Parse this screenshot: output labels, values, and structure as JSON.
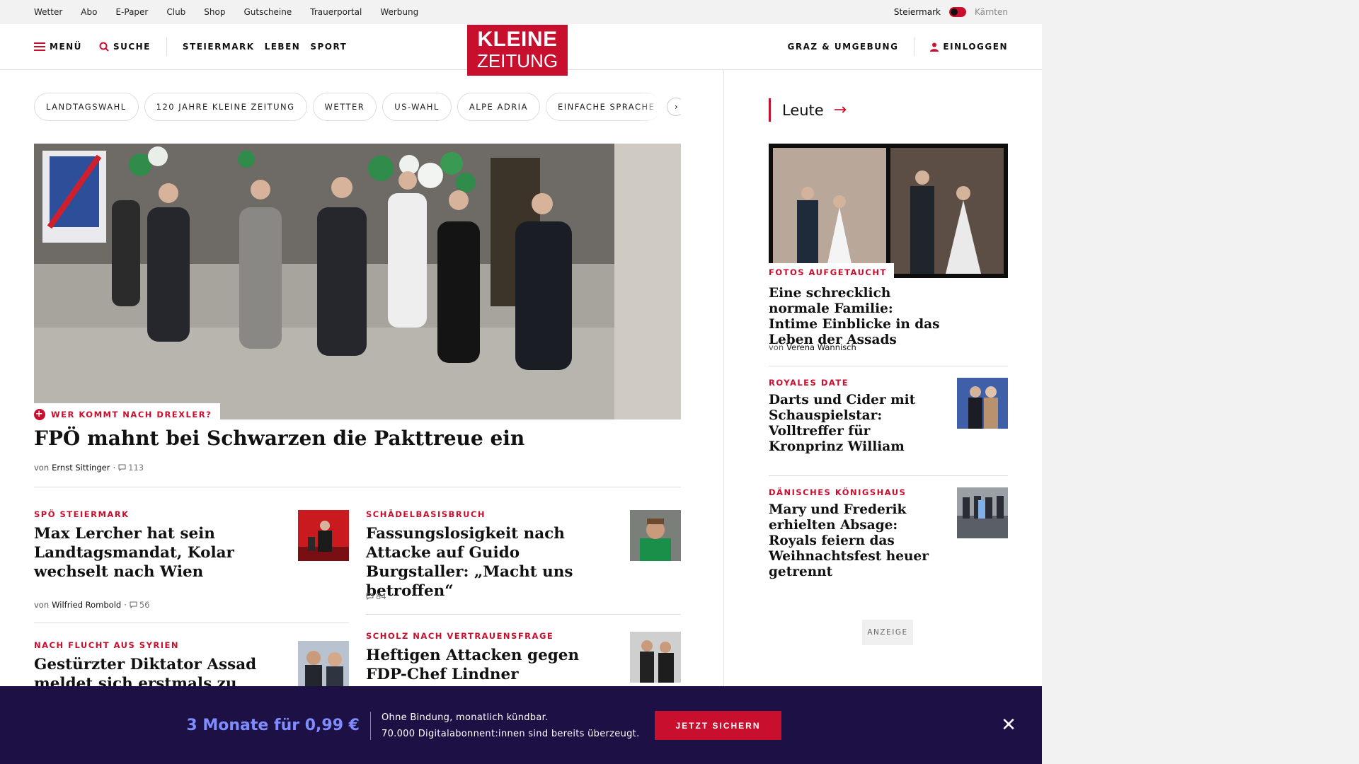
{
  "util": {
    "links": [
      "Wetter",
      "Abo",
      "E-Paper",
      "Club",
      "Shop",
      "Gutscheine",
      "Trauerportal",
      "Werbung"
    ],
    "region_active": "Steiermark",
    "region_other": "Kärnten"
  },
  "header": {
    "menu": "MENÜ",
    "search": "SUCHE",
    "nav": [
      "STEIERMARK",
      "LEBEN",
      "SPORT"
    ],
    "logo_line1": "KLEINE",
    "logo_line2": "ZEITUNG",
    "region_link": "GRAZ & UMGEBUNG",
    "login": "EINLOGGEN"
  },
  "chips": [
    "LANDTAGSWAHL",
    "120 JAHRE KLEINE ZEITUNG",
    "WETTER",
    "US-WAHL",
    "ALPE ADRIA",
    "EINFACHE SPRACHE"
  ],
  "hero": {
    "kicker": "WER KOMMT NACH DREXLER?",
    "title": "FPÖ mahnt bei Schwarzen die Pakttreue ein",
    "by": "von",
    "author": "Ernst Sittinger",
    "comments": "113"
  },
  "articles": [
    {
      "kicker": "SPÖ STEIERMARK",
      "title": "Max Lercher hat sein Landtagsmandat, Kolar wechselt nach Wien",
      "by": "von",
      "author": "Wilfried Rombold",
      "comments": "56"
    },
    {
      "kicker": "SCHÄDELBASISBRUCH",
      "title": "Fassungslosigkeit nach Attacke auf Guido Burgstaller: „Macht uns betroffen“",
      "comments": "84"
    },
    {
      "kicker": "NACH FLUCHT AUS SYRIEN",
      "title": "Gestürzter Diktator Assad meldet sich erstmals zu Wort"
    },
    {
      "kicker": "SCHOLZ NACH VERTRAUENSFRAGE",
      "title": "Heftigen Attacken gegen FDP-Chef Lindner"
    }
  ],
  "side": {
    "section": "Leute",
    "main": {
      "kicker": "FOTOS AUFGETAUCHT",
      "title": "Eine schrecklich normale Familie: Intime Einblicke in das Leben der Assads",
      "by": "von",
      "author": "Verena Wannisch"
    },
    "items": [
      {
        "kicker": "ROYALES DATE",
        "title": "Darts und Cider mit Schauspielstar: Volltreffer für Kronprinz William"
      },
      {
        "kicker": "DÄNISCHES KÖNIGSHAUS",
        "title": "Mary und Frederik erhielten Absage: Royals feiern das Weihnachtsfest heuer getrennt"
      }
    ],
    "ad_label": "ANZEIGE"
  },
  "banner": {
    "offer": "3 Monate für 0,99 €",
    "line1": "Ohne Bindung, monatlich kündbar.",
    "line2": "70.000 Digitalabonnent:innen sind bereits überzeugt.",
    "button": "JETZT SICHERN"
  },
  "colors": {
    "brand": "#c8102e",
    "banner_bg": "#1c1045",
    "offer": "#7f8cff"
  }
}
